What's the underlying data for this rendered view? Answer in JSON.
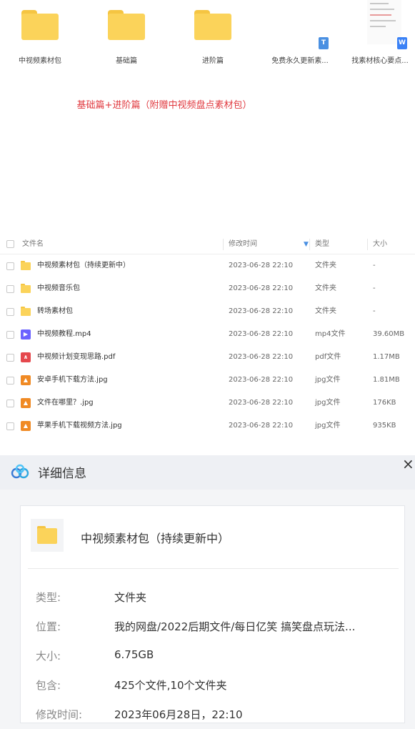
{
  "grid": {
    "items": [
      {
        "label": "中视频素材包",
        "icon": "folder-icon"
      },
      {
        "label": "基础篇",
        "icon": "folder-icon"
      },
      {
        "label": "进阶篇",
        "icon": "folder-icon"
      },
      {
        "label": "免费永久更新素...",
        "icon": "text-doc-icon",
        "badge": "T"
      },
      {
        "label": "找素材核心要点...",
        "icon": "word-doc-icon",
        "badge": "W"
      }
    ],
    "caption": "基础篇+进阶篇（附赠中视频盘点素材包）"
  },
  "list": {
    "headers": {
      "name": "文件名",
      "modified": "修改时间",
      "type": "类型",
      "size": "大小"
    },
    "rows": [
      {
        "name": "中视频素材包（持续更新中）",
        "modified": "2023-06-28 22:10",
        "type": "文件夹",
        "size": "-",
        "icon": "folder-icon"
      },
      {
        "name": "中视频音乐包",
        "modified": "2023-06-28 22:10",
        "type": "文件夹",
        "size": "-",
        "icon": "folder-icon"
      },
      {
        "name": "转场素材包",
        "modified": "2023-06-28 22:10",
        "type": "文件夹",
        "size": "-",
        "icon": "folder-icon"
      },
      {
        "name": "中视频教程.mp4",
        "modified": "2023-06-28 22:10",
        "type": "mp4文件",
        "size": "39.60MB",
        "icon": "video-file-icon"
      },
      {
        "name": "中视频计划变现思路.pdf",
        "modified": "2023-06-28 22:10",
        "type": "pdf文件",
        "size": "1.17MB",
        "icon": "pdf-file-icon"
      },
      {
        "name": "安卓手机下载方法.jpg",
        "modified": "2023-06-28 22:10",
        "type": "jpg文件",
        "size": "1.81MB",
        "icon": "image-file-icon"
      },
      {
        "name": "文件在哪里？.jpg",
        "modified": "2023-06-28 22:10",
        "type": "jpg文件",
        "size": "176KB",
        "icon": "image-file-icon"
      },
      {
        "name": "苹果手机下载视频方法.jpg",
        "modified": "2023-06-28 22:10",
        "type": "jpg文件",
        "size": "935KB",
        "icon": "image-file-icon"
      }
    ]
  },
  "details": {
    "title": "详细信息",
    "close": "×",
    "name": "中视频素材包（持续更新中）",
    "props": [
      {
        "label": "类型:",
        "value": "文件夹"
      },
      {
        "label": "位置:",
        "value": "我的网盘/2022后期文件/每日亿笑 搞笑盘点玩法..."
      },
      {
        "label": "大小:",
        "value": "6.75GB"
      },
      {
        "label": "包含:",
        "value": "425个文件,10个文件夹"
      },
      {
        "label": "修改时间:",
        "value": "2023年06月28日，22:10"
      }
    ]
  },
  "colors": {
    "folder": "#fbd35a",
    "caption": "#e0383e",
    "accent": "#4a90e2",
    "video": "#6c63ff",
    "pdf": "#e5484d",
    "image": "#f08a24"
  }
}
